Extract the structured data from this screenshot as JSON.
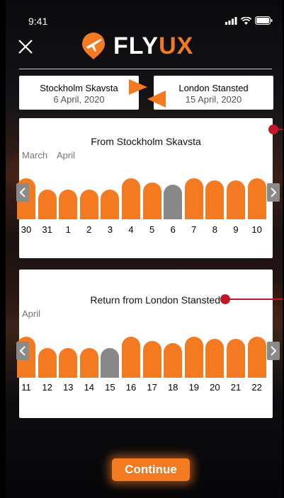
{
  "status": {
    "time": "9:41"
  },
  "header": {
    "brand_left": "FLY",
    "brand_right": "UX"
  },
  "route": {
    "from": {
      "name": "Stockholm Skavsta",
      "date": "6 April, 2020"
    },
    "to": {
      "name": "London Stansted",
      "date": "15 April, 2020"
    }
  },
  "outbound": {
    "title": "From Stockholm Skavsta",
    "months": [
      "March",
      "April"
    ],
    "days": [
      "30",
      "31",
      "1",
      "2",
      "3",
      "4",
      "5",
      "6",
      "7",
      "8",
      "9",
      "10"
    ],
    "bar_levels": [
      0.8,
      0.58,
      0.58,
      0.58,
      0.58,
      0.8,
      0.72,
      0.68,
      0.8,
      0.76,
      0.76,
      0.8
    ],
    "selected_day": "6"
  },
  "return": {
    "title": "Return from London Stansted",
    "months": [
      "April"
    ],
    "days": [
      "11",
      "12",
      "13",
      "14",
      "15",
      "16",
      "17",
      "18",
      "19",
      "20",
      "21",
      "22"
    ],
    "bar_levels": [
      0.8,
      0.58,
      0.58,
      0.58,
      0.58,
      0.8,
      0.72,
      0.68,
      0.8,
      0.76,
      0.76,
      0.8
    ],
    "selected_day": "15"
  },
  "footer": {
    "continue_label": "Continue"
  },
  "colors": {
    "accent": "#f47a22",
    "selected": "#888888",
    "annotation": "#c0182a"
  }
}
